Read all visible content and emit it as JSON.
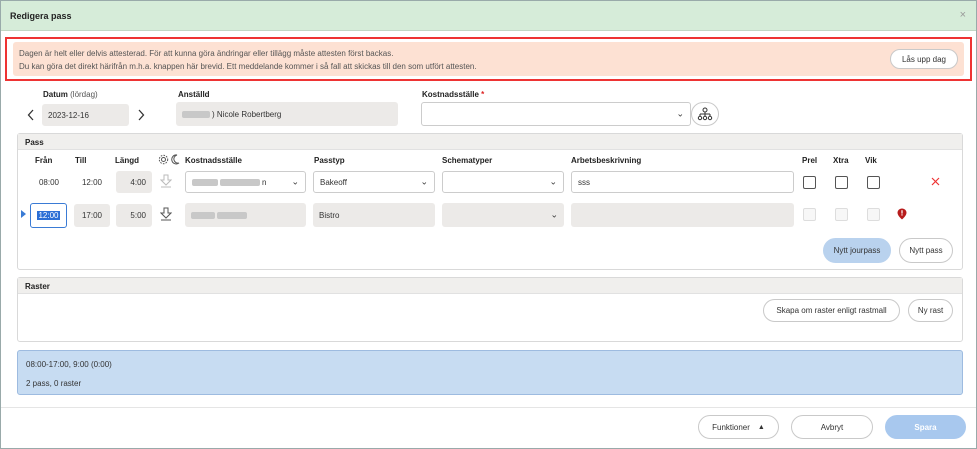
{
  "dialog": {
    "title": "Redigera pass",
    "close_icon": "×"
  },
  "warning": {
    "line1": "Dagen är helt eller delvis attesterad. För att kunna göra ändringar eller tillägg måste attesten först backas.",
    "line2": "Du kan göra det direkt härifrån m.h.a. knappen här brevid. Ett meddelande kommer i så fall att skickas till den som utfört attesten.",
    "unlock_button": "Lås upp dag"
  },
  "header": {
    "date_label": "Datum",
    "date_sublabel": "(lördag)",
    "date_value": "2023-12-16",
    "prev_icon": "chevron-left-icon",
    "next_icon": "chevron-right-icon",
    "employee_label": "Anställd",
    "employee_value": ") Nicole Robertberg",
    "cost_center_label": "Kostnadsställe",
    "cost_center_required": "*",
    "cost_center_value": "",
    "org_icon": "org-chart-icon"
  },
  "pass": {
    "title": "Pass",
    "columns": {
      "from": "Från",
      "to": "Till",
      "length": "Längd",
      "cost_center": "Kostnadsställe",
      "shift_type": "Passtyp",
      "schedule_types": "Schematyper",
      "work_description": "Arbetsbeskrivning",
      "prel": "Prel",
      "xtra": "Xtra",
      "vik": "Vik"
    },
    "rows": [
      {
        "from": "08:00",
        "to": "12:00",
        "length": "4:00",
        "cost_center_suffix": "n",
        "shift_type": "Bakeoff",
        "schedule_type": "",
        "work_description": "sss"
      },
      {
        "from": "12:00",
        "to": "17:00",
        "length": "5:00",
        "cost_center_suffix": "",
        "shift_type": "Bistro",
        "schedule_type": "",
        "work_description": ""
      }
    ],
    "new_on_call_button": "Nytt jourpass",
    "new_shift_button": "Nytt pass"
  },
  "breaks": {
    "title": "Raster",
    "recreate_button": "Skapa om raster enligt rastmall",
    "new_break_button": "Ny rast"
  },
  "summary": {
    "line1": "08:00-17:00, 9:00 (0:00)",
    "line2": "2 pass, 0 raster"
  },
  "footer": {
    "functions_button": "Funktioner",
    "cancel_button": "Avbryt",
    "save_button": "Spara"
  },
  "colors": {
    "title_bar": "#d6ecd9",
    "warning_bg": "#fde1d3",
    "warning_border": "#ee3333",
    "summary_bg": "#c7dcf2",
    "accent": "#a8c8ee",
    "delete": "#e33333",
    "alert": "#b71c1c"
  }
}
